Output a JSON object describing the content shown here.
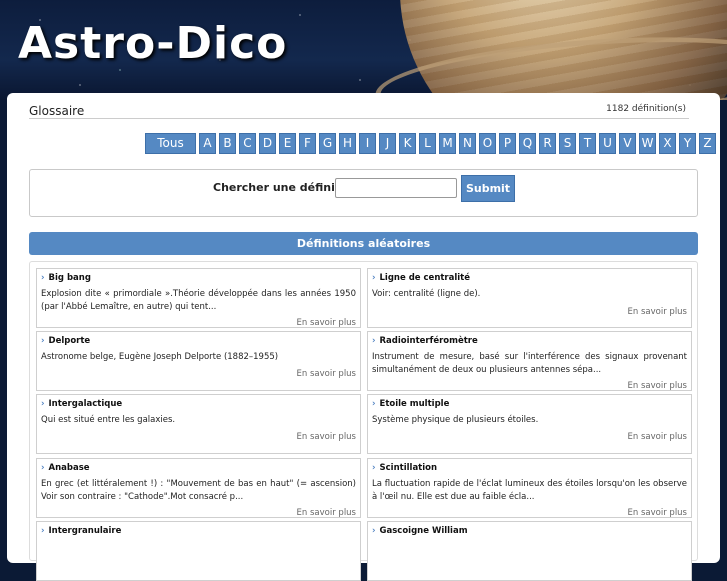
{
  "site": {
    "logo": "Astro-Dico"
  },
  "glossary": {
    "title": "Glossaire",
    "count": "1182 définition(s)",
    "letters": [
      "Tous",
      "A",
      "B",
      "C",
      "D",
      "E",
      "F",
      "G",
      "H",
      "I",
      "J",
      "K",
      "L",
      "M",
      "N",
      "O",
      "P",
      "Q",
      "R",
      "S",
      "T",
      "U",
      "V",
      "W",
      "X",
      "Y",
      "Z"
    ]
  },
  "search": {
    "label": "Chercher une définition",
    "value": "",
    "submit_label": "Submit"
  },
  "random": {
    "header": "Définitions aléatoires",
    "more_label": "En savoir plus",
    "items": [
      {
        "title": "Big bang",
        "desc": "Explosion dite « primordiale ».Théorie développée dans les années 1950 (par l'Abbé Lemaître, en autre) qui tent..."
      },
      {
        "title": "Ligne de centralité",
        "desc": "Voir: centralité (ligne de)."
      },
      {
        "title": "Delporte",
        "desc": "Astronome belge, Eugène Joseph Delporte (1882–1955)"
      },
      {
        "title": "Radiointerféromètre",
        "desc": "Instrument de mesure, basé sur l'interférence des signaux provenant simultanément de deux ou plusieurs antennes sépa..."
      },
      {
        "title": "Intergalactique",
        "desc": "Qui est situé entre les galaxies."
      },
      {
        "title": "Etoile multiple",
        "desc": "Système physique de plusieurs étoiles."
      },
      {
        "title": "Anabase",
        "desc": "En grec (et littéralement !) : \"Mouvement de bas en haut\" (= ascension) Voir son contraire : \"Cathode\".Mot consacré p..."
      },
      {
        "title": "Scintillation",
        "desc": "La fluctuation rapide de l'éclat lumineux des étoiles lorsqu'on les observe à l'œil nu. Elle est due au faible écla..."
      },
      {
        "title": "Intergranulaire",
        "desc": ""
      },
      {
        "title": "Gascoigne William",
        "desc": ""
      }
    ]
  }
}
